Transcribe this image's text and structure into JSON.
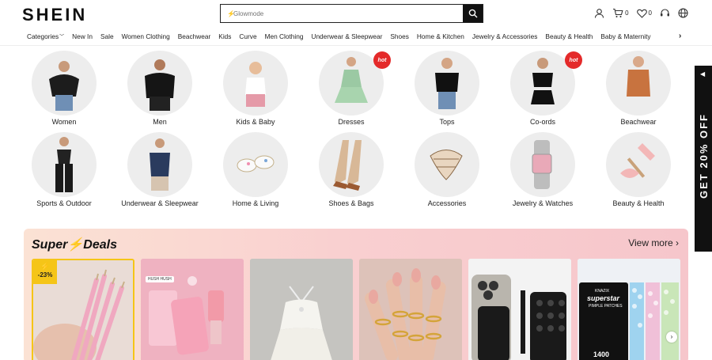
{
  "header": {
    "logo": "SHEIN",
    "search_placeholder": "Glowmode",
    "cart_count": "0",
    "wishlist_count": "0"
  },
  "nav": {
    "items": [
      "Categories",
      "New In",
      "Sale",
      "Women Clothing",
      "Beachwear",
      "Kids",
      "Curve",
      "Men Clothing",
      "Underwear & Sleepwear",
      "Shoes",
      "Home & Kitchen",
      "Jewelry & Accessories",
      "Beauty & Health",
      "Baby & Maternity"
    ]
  },
  "categories": [
    {
      "label": "Women",
      "hot": false
    },
    {
      "label": "Men",
      "hot": false
    },
    {
      "label": "Kids & Baby",
      "hot": false
    },
    {
      "label": "Dresses",
      "hot": true
    },
    {
      "label": "Tops",
      "hot": false
    },
    {
      "label": "Co-ords",
      "hot": true
    },
    {
      "label": "Beachwear",
      "hot": false
    },
    {
      "label": "Sports & Outdoor",
      "hot": false
    },
    {
      "label": "Underwear & Sleepwear",
      "hot": false
    },
    {
      "label": "Home & Living",
      "hot": false
    },
    {
      "label": "Shoes & Bags",
      "hot": false
    },
    {
      "label": "Accessories",
      "hot": false
    },
    {
      "label": "Jewelry & Watches",
      "hot": false
    },
    {
      "label": "Beauty & Health",
      "hot": false
    }
  ],
  "hot_label": "hot",
  "side_banner": {
    "text": "GET 20% OFF"
  },
  "deals": {
    "title_part1": "Super",
    "title_part2": "Deals",
    "view_more": "View more",
    "badge_text": "-23%",
    "tag1": "HUSH HUSH",
    "pack_brand": "KNAZIX",
    "pack_line": "superstar",
    "pack_sub": "PIMPLE PATCHES",
    "pack_count": "1400"
  },
  "colors": {
    "accent": "#e42a2a",
    "side_banner": "#111111",
    "badge": "#f5c518"
  }
}
